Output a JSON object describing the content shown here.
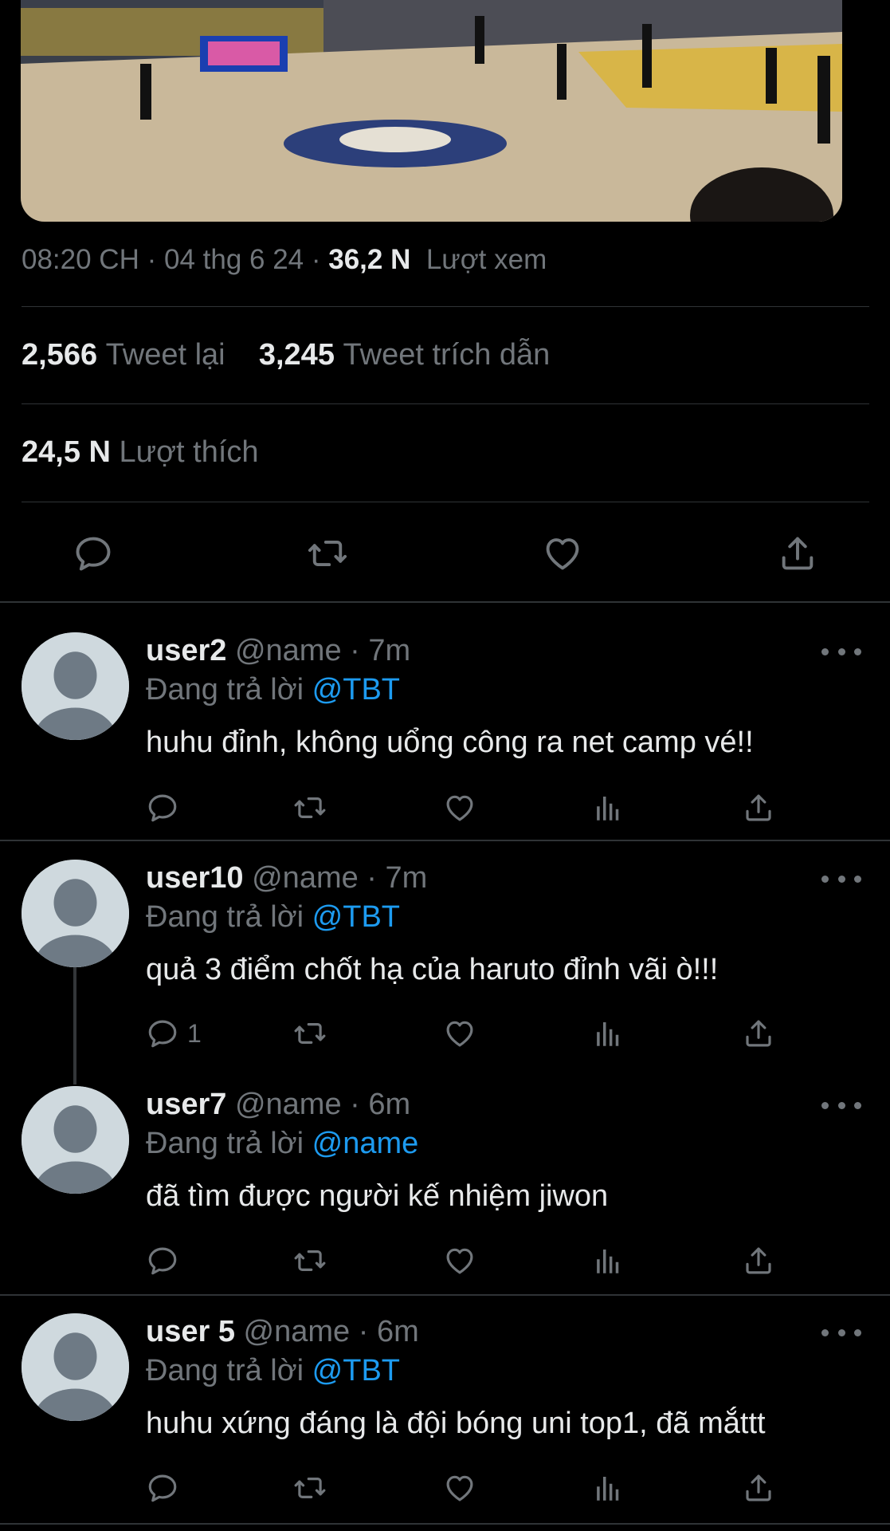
{
  "tweet": {
    "time": "08:20 CH",
    "sep1": " · ",
    "date": "04 thg 6 24",
    "sep2": " · ",
    "views_count": "36,2 N",
    "views_label": "Lượt xem",
    "retweets_count": "2,566",
    "retweets_label": "Tweet lại",
    "quotes_count": "3,245",
    "quotes_label": "Tweet trích dẫn",
    "likes_count": "24,5 N",
    "likes_label": "Lượt thích"
  },
  "icons": {
    "reply": "reply-icon",
    "retweet": "retweet-icon",
    "like": "heart-icon",
    "share": "share-icon",
    "views": "bar-chart-icon",
    "more": "more-icon",
    "avatar": "default-avatar-icon"
  },
  "colors": {
    "background": "#000000",
    "text": "#e7e9ea",
    "muted": "#71767b",
    "accent": "#1d9bf0",
    "divider": "#2f3336"
  },
  "replies": [
    {
      "user": "user2",
      "handle": "@name",
      "sep": " · ",
      "time": "7m",
      "replying_prefix": "Đang trả lời ",
      "replying_to": "@TBT",
      "text": "huhu đỉnh, không uổng công ra net camp vé!!",
      "reply_count": ""
    },
    {
      "user": "user10",
      "handle": "@name",
      "sep": " · ",
      "time": "7m",
      "replying_prefix": "Đang trả lời ",
      "replying_to": "@TBT",
      "text": "quả 3 điểm chốt hạ của haruto đỉnh vãi ò!!!",
      "reply_count": "1"
    },
    {
      "user": "user7",
      "handle": "@name",
      "sep": " · ",
      "time": "6m",
      "replying_prefix": "Đang trả lời ",
      "replying_to": "@name",
      "text": "đã tìm được người kế nhiệm jiwon",
      "reply_count": ""
    },
    {
      "user": "user 5",
      "handle": "@name",
      "sep": " · ",
      "time": "6m",
      "replying_prefix": "Đang trả lời ",
      "replying_to": "@TBT",
      "text": "huhu xứng đáng là đội bóng uni top1, đã mắttt",
      "reply_count": ""
    }
  ]
}
